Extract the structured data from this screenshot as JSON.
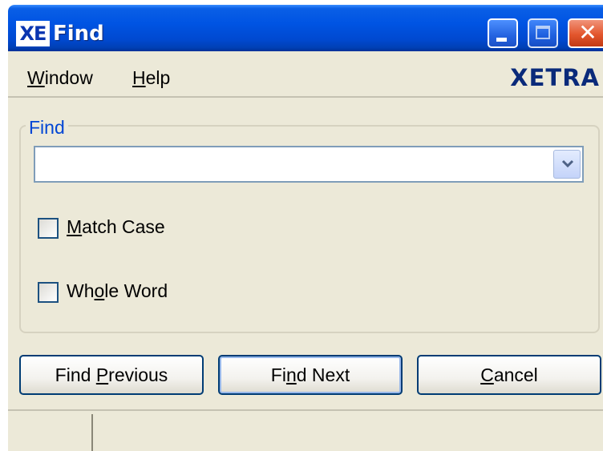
{
  "window": {
    "title": "Find",
    "app_icon_text": "XE",
    "controls": [
      "minimize",
      "maximize",
      "close"
    ],
    "close_glyph": "✕"
  },
  "menubar": {
    "items": [
      {
        "label_mnemonic": "W",
        "label_rest": "indow"
      },
      {
        "label_mnemonic": "H",
        "label_rest": "elp"
      }
    ],
    "brand": "XETRA"
  },
  "find_group": {
    "label": "Find",
    "combo_value": "",
    "match_case": {
      "pre": "",
      "mnemonic": "M",
      "post": "atch Case",
      "checked": false
    },
    "whole_word": {
      "pre": "Wh",
      "mnemonic": "o",
      "post": "le Word",
      "checked": false
    }
  },
  "buttons": {
    "prev": {
      "pre": "Find ",
      "mnemonic": "P",
      "post": "revious"
    },
    "next": {
      "pre": "Fi",
      "mnemonic": "n",
      "post": "d Next"
    },
    "cancel": {
      "pre": "",
      "mnemonic": "C",
      "post": "ancel"
    }
  },
  "statusbar": {
    "pane1": "",
    "pane2": ""
  }
}
